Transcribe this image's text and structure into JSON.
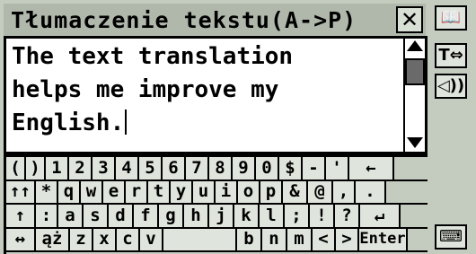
{
  "window": {
    "title": "Tłumaczenie tekstu(A->P)",
    "close_label": "✕"
  },
  "editor": {
    "text": "The text translation\nhelps me improve my\nEnglish."
  },
  "sidebar": {
    "book_icon": "📖",
    "swap_label": "T⇔",
    "speak_label": "◁))",
    "keyboard_icon": "⌨"
  },
  "keyboard": {
    "rows": [
      [
        "(",
        ")",
        "1",
        "2",
        "3",
        "4",
        "5",
        "6",
        "7",
        "8",
        "9",
        "0",
        "$",
        "-",
        "'",
        "←"
      ],
      [
        "↑↑",
        "*",
        "q",
        "w",
        "e",
        "r",
        "t",
        "y",
        "u",
        "i",
        "o",
        "p",
        "&",
        "@",
        ",",
        "."
      ],
      [
        "↑",
        ":",
        "a",
        "s",
        "d",
        "f",
        "g",
        "h",
        "j",
        "k",
        "l",
        ";",
        "!",
        "?",
        "↵"
      ],
      [
        "↔",
        "ąż",
        "z",
        "x",
        "c",
        "v",
        "",
        "b",
        "n",
        "m",
        "<",
        ">",
        "Enter"
      ]
    ]
  }
}
